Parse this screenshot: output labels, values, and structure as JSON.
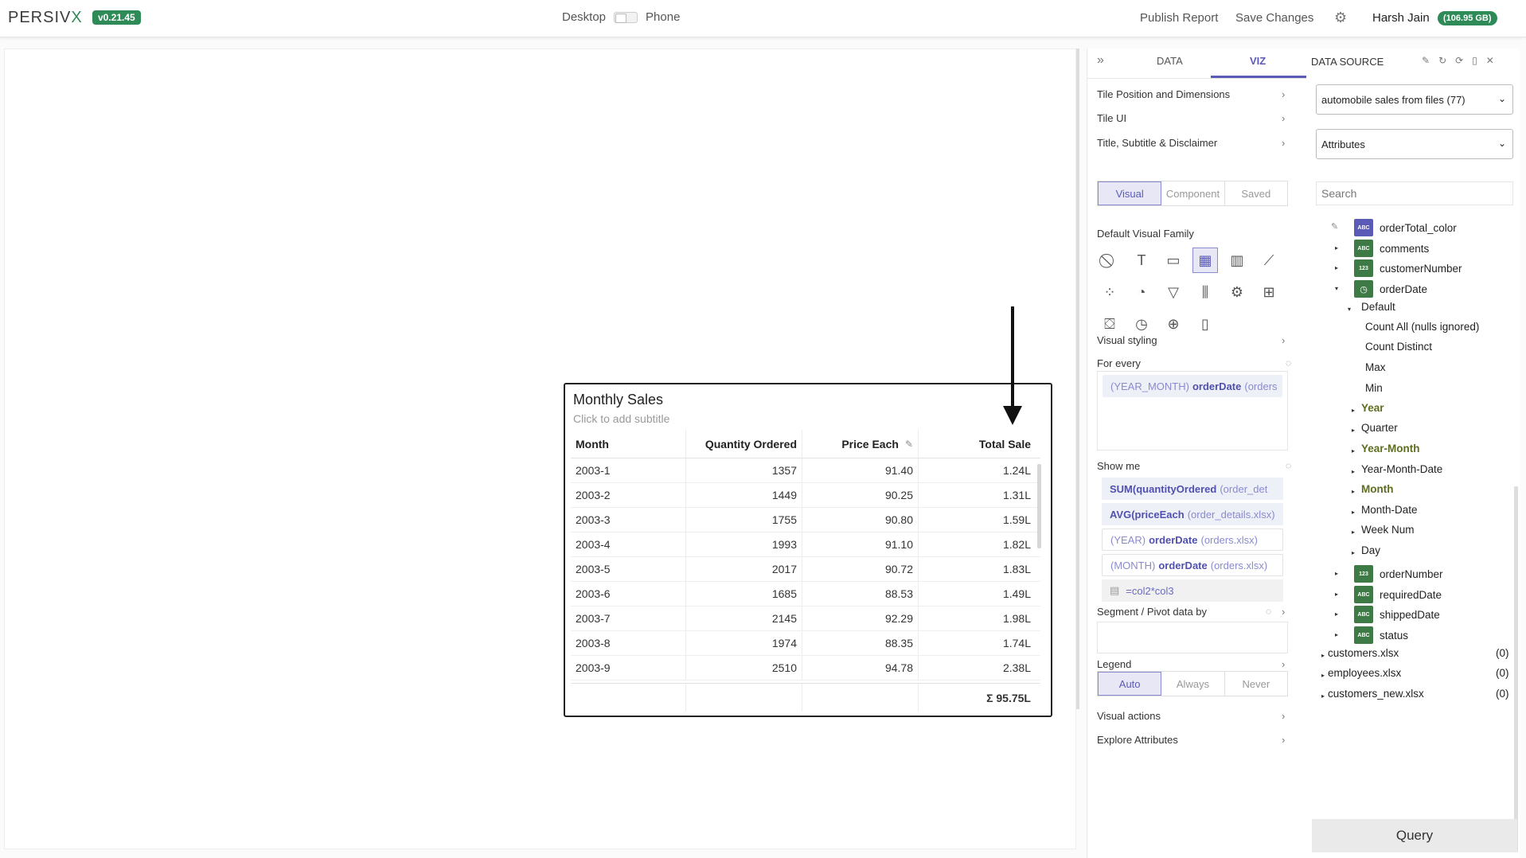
{
  "header": {
    "logo": "PERSIV",
    "logo_x": "X",
    "version": "v0.21.45",
    "desktop_label": "Desktop",
    "phone_label": "Phone",
    "publish_label": "Publish Report",
    "save_label": "Save Changes",
    "user_name": "Harsh Jain",
    "storage": "(106.95 GB)"
  },
  "tile": {
    "title": "Monthly Sales",
    "subtitle": "Click to add subtitle",
    "columns": [
      "Month",
      "Quantity Ordered",
      "Price Each",
      "Total Sale"
    ],
    "rows": [
      [
        "2003-1",
        "1357",
        "91.40",
        "1.24L"
      ],
      [
        "2003-2",
        "1449",
        "90.25",
        "1.31L"
      ],
      [
        "2003-3",
        "1755",
        "90.80",
        "1.59L"
      ],
      [
        "2003-4",
        "1993",
        "91.10",
        "1.82L"
      ],
      [
        "2003-5",
        "2017",
        "90.72",
        "1.83L"
      ],
      [
        "2003-6",
        "1685",
        "88.53",
        "1.49L"
      ],
      [
        "2003-7",
        "2145",
        "92.29",
        "1.98L"
      ],
      [
        "2003-8",
        "1974",
        "88.35",
        "1.74L"
      ],
      [
        "2003-9",
        "2510",
        "94.78",
        "2.38L"
      ]
    ],
    "total": "Σ 95.75L"
  },
  "panel": {
    "tab_data": "DATA",
    "tab_viz": "VIZ",
    "datasource_title": "DATA SOURCE",
    "sections": {
      "tile_position": "Tile Position and Dimensions",
      "tile_ui": "Tile UI",
      "title_subtitle": "Title, Subtitle & Disclaimer",
      "default_visual_family": "Default Visual Family",
      "visual_styling": "Visual styling",
      "for_every": "For every",
      "show_me": "Show me",
      "segment": "Segment / Pivot data by",
      "legend": "Legend",
      "visual_actions": "Visual actions",
      "explore_attributes": "Explore Attributes"
    },
    "mode_tabs": [
      "Visual",
      "Component",
      "Saved"
    ],
    "legend_options": [
      "Auto",
      "Always",
      "Never"
    ],
    "for_every_pill": {
      "prefix": "(YEAR_MONTH)",
      "field": "orderDate",
      "suffix": "(orders"
    },
    "show_me_pills": [
      {
        "prefix": "SUM(",
        "field": "quantityOrdered",
        "suffix": "(order_det"
      },
      {
        "prefix": "AVG(",
        "field": "priceEach",
        "suffix": "(order_details.xlsx)"
      },
      {
        "prefix": "(YEAR)",
        "field": "orderDate",
        "suffix": "(orders.xlsx)"
      },
      {
        "prefix": "(MONTH)",
        "field": "orderDate",
        "suffix": "(orders.xlsx)"
      }
    ],
    "formula": "=col2*col3"
  },
  "datasource": {
    "source_select": "automobile sales from files (77)",
    "mode_select": "Attributes",
    "search_placeholder": "Search",
    "fields": [
      {
        "badge": "ABC",
        "label": "orderTotal_color"
      },
      {
        "badge": "ABC",
        "label": "comments"
      },
      {
        "badge": "123",
        "label": "customerNumber"
      },
      {
        "badge": "clock",
        "label": "orderDate"
      }
    ],
    "default_group": "Default",
    "default_items": [
      "Count All (nulls ignored)",
      "Count Distinct",
      "Max",
      "Min"
    ],
    "date_parts": [
      "Year",
      "Quarter",
      "Year-Month",
      "Year-Month-Date",
      "Month",
      "Month-Date",
      "Week Num",
      "Day"
    ],
    "more_fields": [
      {
        "badge": "123",
        "label": "orderNumber"
      },
      {
        "badge": "ABC",
        "label": "requiredDate"
      },
      {
        "badge": "ABC",
        "label": "shippedDate"
      },
      {
        "badge": "ABC",
        "label": "status"
      }
    ],
    "files": [
      {
        "name": "customers.xlsx",
        "count": "(0)"
      },
      {
        "name": "employees.xlsx",
        "count": "(0)"
      },
      {
        "name": "customers_new.xlsx",
        "count": "(0)"
      }
    ],
    "query_label": "Query"
  }
}
